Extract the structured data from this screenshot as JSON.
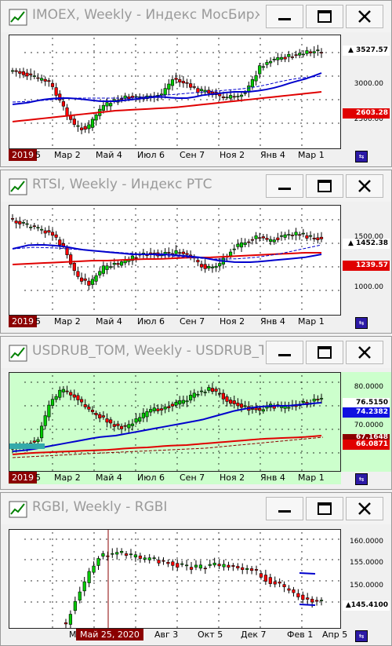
{
  "windows": [
    {
      "title": "IMOEX, Weekly - Индекс МосБиржи",
      "yticks": [
        "3000.00",
        "2500.00"
      ],
      "price_tags": [
        {
          "text": "▲ 3527.57",
          "color": "#000000",
          "bg": "#ffffff"
        },
        {
          "text": "2603.28",
          "color": "#ffffff",
          "bg": "#e00000"
        }
      ],
      "year_label": "2019",
      "x_labels": [
        "5",
        "Мар 2",
        "Май 4",
        "Июл 6",
        "Сен 7",
        "Ноя 2",
        "Янв 4",
        "Мар 1"
      ],
      "nav_label": "⇆"
    },
    {
      "title": "RTSI, Weekly - Индекс РТС",
      "yticks": [
        "1500.00",
        "1000.00"
      ],
      "price_tags": [
        {
          "text": "▲ 1452.38",
          "color": "#000000",
          "bg": "#ffffff"
        },
        {
          "text": "1239.57",
          "color": "#ffffff",
          "bg": "#e00000"
        }
      ],
      "year_label": "2019",
      "x_labels": [
        "5",
        "Мар 2",
        "Май 4",
        "Июл 6",
        "Сен 7",
        "Ноя 2",
        "Янв 4",
        "Мар 1"
      ],
      "nav_label": "⇆"
    },
    {
      "title": "USDRUB_TOM, Weekly - USDRUB_T...",
      "yticks": [
        "80.0000",
        "70.0000"
      ],
      "price_tags": [
        {
          "text": "76.5150",
          "color": "#000000",
          "bg": "#ffffff"
        },
        {
          "text": "74.2382",
          "color": "#ffffff",
          "bg": "#1010e0"
        },
        {
          "text": "67.1648",
          "color": "#ffffff",
          "bg": "#8b0000"
        },
        {
          "text": "66.0871",
          "color": "#ffffff",
          "bg": "#e00000"
        }
      ],
      "year_label": "2019",
      "x_labels": [
        "5",
        "Мар 2",
        "Май 4",
        "Июл 6",
        "Сен 7",
        "Ноя 2",
        "Янв 4",
        "Мар 1"
      ],
      "nav_label": "⇆"
    },
    {
      "title": "RGBI, Weekly - RGBI",
      "yticks": [
        "160.0000",
        "155.0000",
        "150.0000"
      ],
      "price_tags": [
        {
          "text": "▲145.4100",
          "color": "#000000",
          "bg": "#ffffff"
        }
      ],
      "cursor_label": "Май 25, 2020",
      "x_labels": [
        "Ма",
        "Авг 3",
        "Окт 5",
        "Дек 7",
        "Фев 1",
        "Апр 5"
      ],
      "nav_label": "⇆"
    }
  ],
  "colors": {
    "candle_up": "#00cc00",
    "candle_down": "#ff0000",
    "ma_fast": "#0000cc",
    "ma_slow": "#e00000",
    "green_bg": "#ccffcc"
  }
}
